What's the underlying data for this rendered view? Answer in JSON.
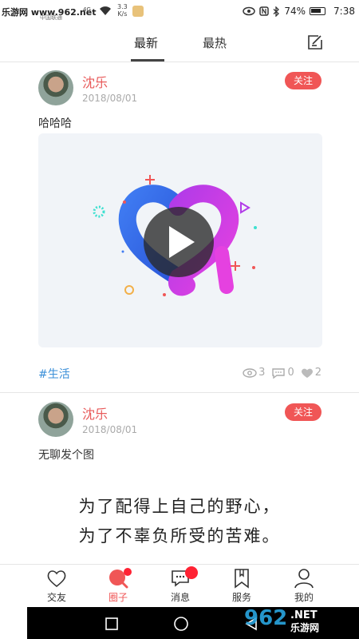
{
  "status_bar": {
    "site": "乐游网 www.962.net",
    "carrier": "中国联通",
    "network": "4G",
    "speed_value": "3.3",
    "speed_unit": "K/s",
    "battery": "74%",
    "time": "7:38"
  },
  "tabs": [
    {
      "label": "最新",
      "active": true
    },
    {
      "label": "最热",
      "active": false
    }
  ],
  "posts": [
    {
      "author": "沈乐",
      "date": "2018/08/01",
      "follow_label": "关注",
      "text": "哈哈哈",
      "tag": "#生活",
      "views": "3",
      "comments": "0",
      "likes": "2"
    },
    {
      "author": "沈乐",
      "date": "2018/08/01",
      "follow_label": "关注",
      "text": "无聊发个图",
      "quote_line1": "为了配得上自己的野心，",
      "quote_line2": "为了不辜负所受的苦难。"
    }
  ],
  "bottom_nav": [
    {
      "label": "交友",
      "icon": "heart-icon"
    },
    {
      "label": "圈子",
      "icon": "circle-search-icon",
      "active": true
    },
    {
      "label": "消息",
      "icon": "chat-icon"
    },
    {
      "label": "服务",
      "icon": "bookmark-icon"
    },
    {
      "label": "我的",
      "icon": "person-icon"
    }
  ],
  "watermark": "962.NET 乐游网",
  "colors": {
    "accent": "#f05656",
    "tag": "#3a8fd8",
    "muted": "#aaaaaa"
  }
}
